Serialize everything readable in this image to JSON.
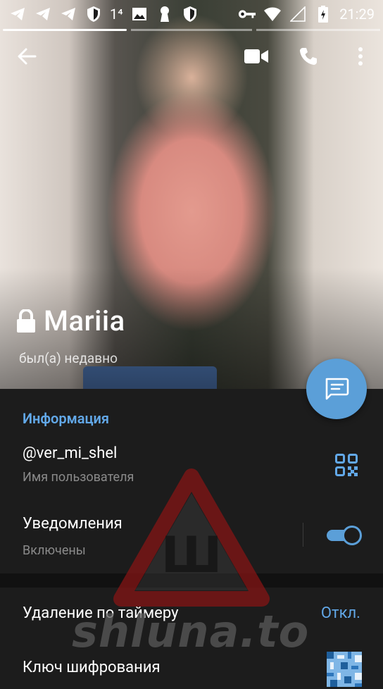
{
  "status_bar": {
    "time": "21:29",
    "signal_text": "1⁴",
    "icons_left": [
      "telegram-icon",
      "telegram-icon",
      "telegram-icon",
      "shield-icon",
      "signal-text",
      "image-icon",
      "keyhole-icon",
      "shield-icon"
    ],
    "icons_right": [
      "vpn-key-icon",
      "wifi-icon",
      "signal-icon",
      "battery-icon"
    ]
  },
  "toolbar": {
    "back": "arrow-back-icon",
    "video": "video-call-icon",
    "call": "phone-icon",
    "menu": "more-vert-icon"
  },
  "profile": {
    "name": "Mariia",
    "status": "был(а) недавно",
    "secret_chat_icon": "lock-icon"
  },
  "info": {
    "section_title": "Информация",
    "username": "@ver_mi_shel",
    "username_label": "Имя пользователя",
    "notifications_title": "Уведомления",
    "notifications_state": "Включены",
    "notifications_on": true,
    "timer_title": "Удаление по таймеру",
    "timer_value": "Откл.",
    "key_title": "Ключ шифрования"
  },
  "watermark": {
    "text": "shluna.to",
    "sign_letter": "Ш"
  },
  "colors": {
    "accent": "#62a8e8",
    "fab": "#5b9fd8",
    "background": "#1c1c1c"
  }
}
